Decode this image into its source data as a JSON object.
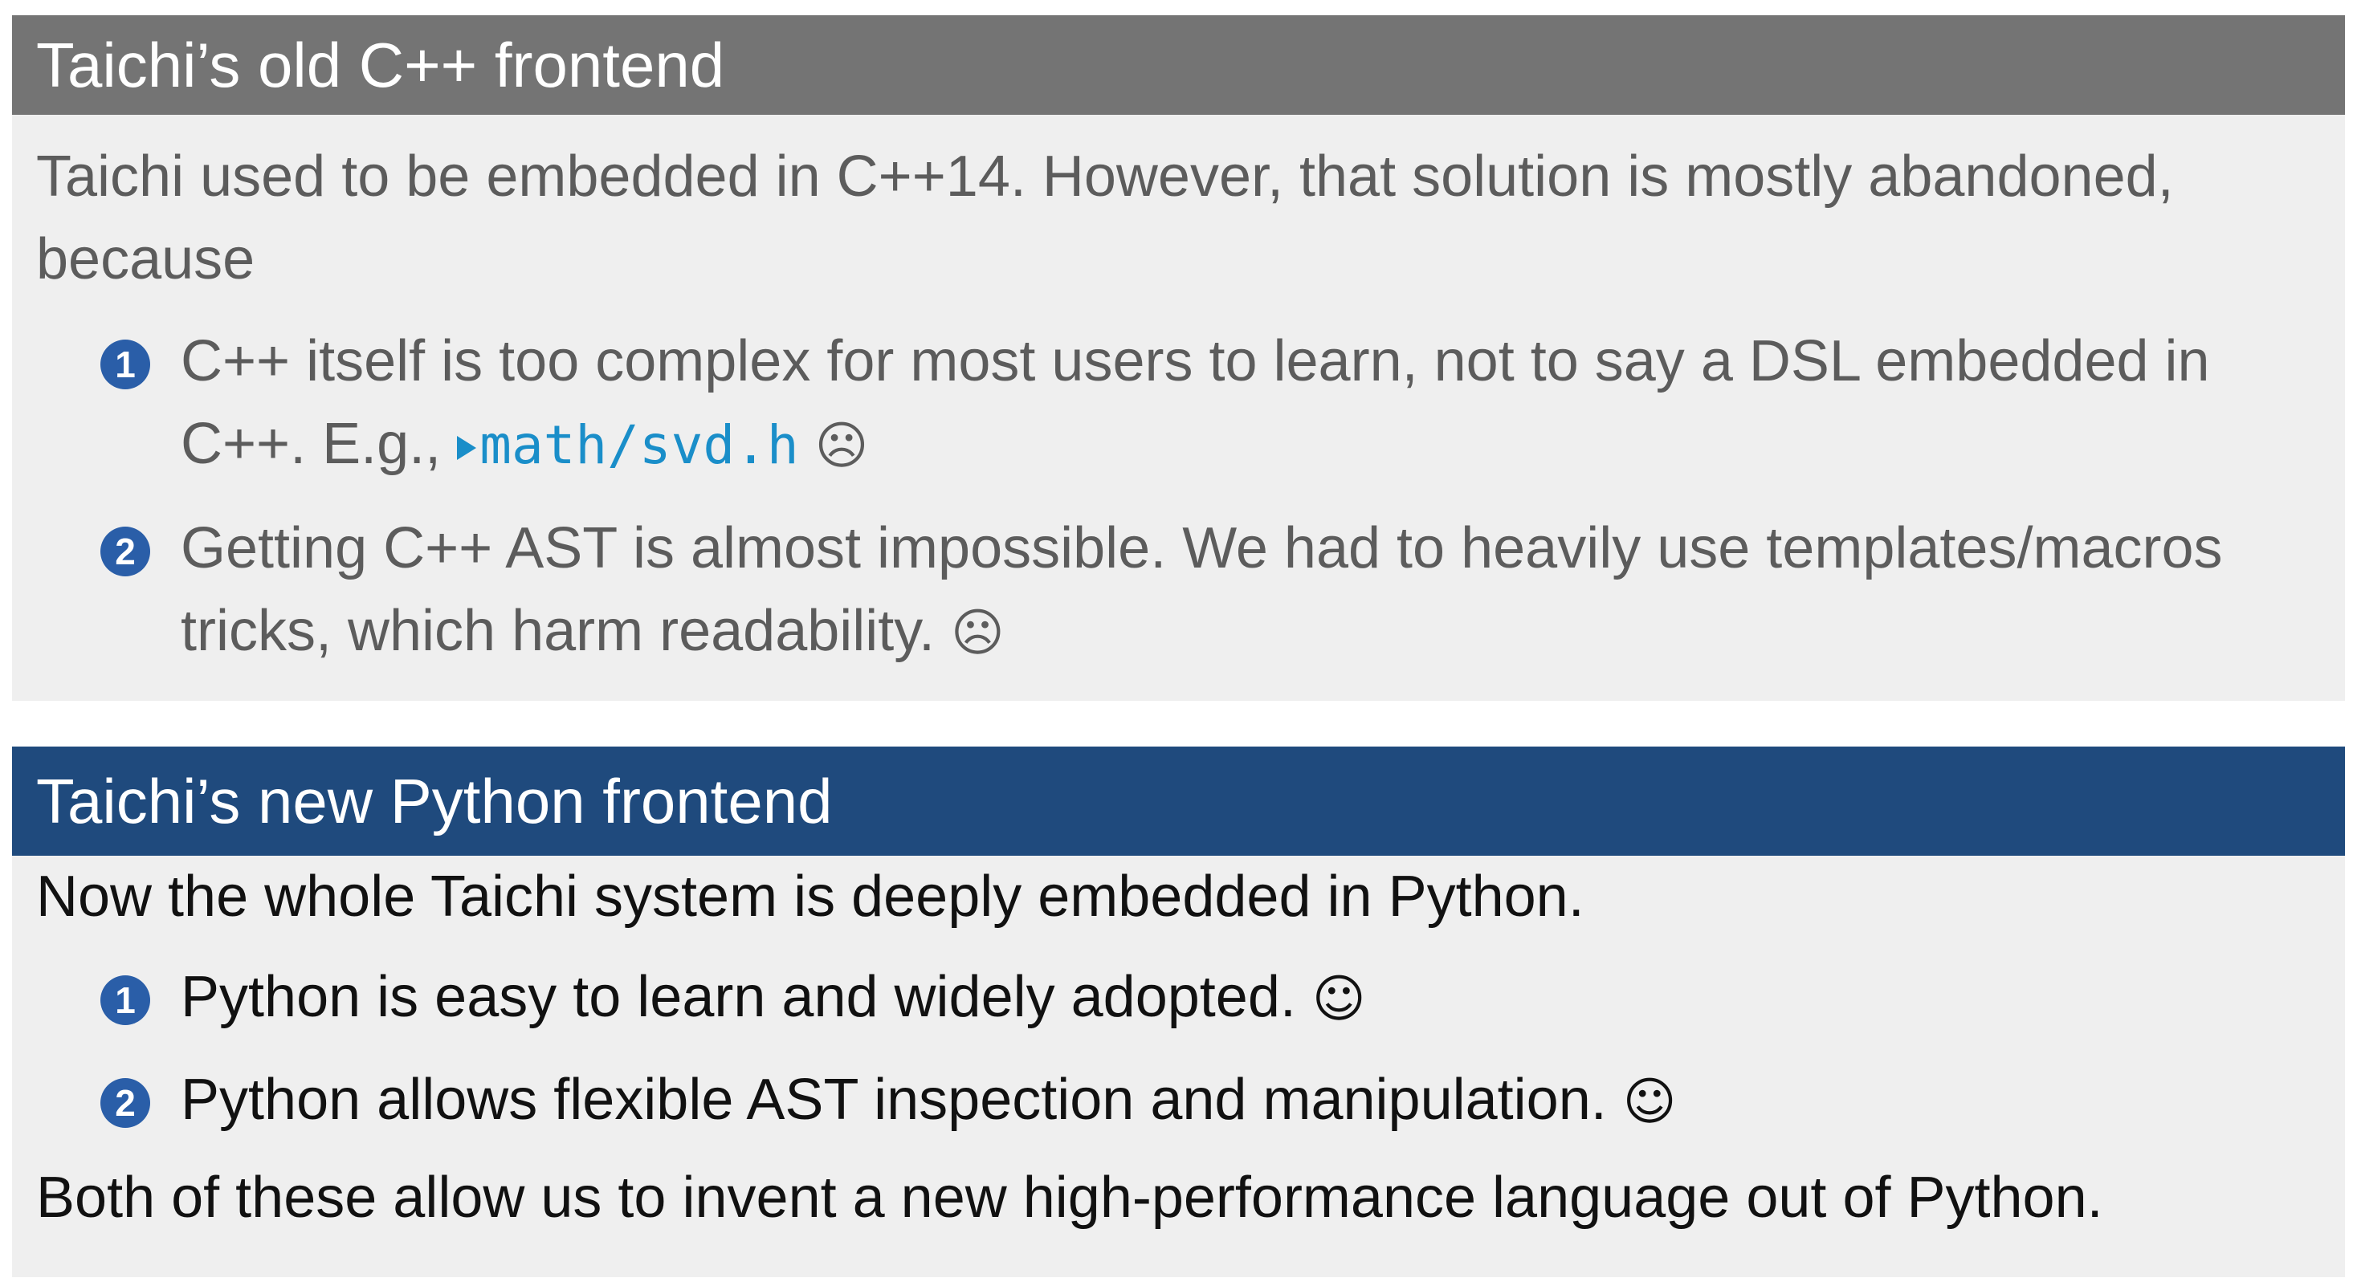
{
  "old_block": {
    "title": "Taichi’s old C++ frontend",
    "intro": "Taichi used to be embedded in C++14. However, that solution is mostly abandoned, because",
    "items": [
      {
        "number": "1",
        "text_before_link": "C++ itself is too complex for most users to learn, not to say a DSL embedded in C++. E.g.,",
        "link_text": "math/svd.h",
        "emoji": "☹"
      },
      {
        "number": "2",
        "text": "Getting C++ AST is almost impossible. We had to heavily use templates/macros tricks, which harm readability.",
        "emoji": "☹"
      }
    ]
  },
  "new_block": {
    "title": "Taichi’s new Python frontend",
    "intro": "Now the whole Taichi system is deeply embedded in Python.",
    "items": [
      {
        "number": "1",
        "text": "Python is easy to learn and widely adopted.",
        "emoji": "☺"
      },
      {
        "number": "2",
        "text": "Python allows flexible AST inspection and manipulation.",
        "emoji": "☺"
      }
    ],
    "conclusion": "Both of these allow us to invent a new high-performance language out of Python."
  },
  "colors": {
    "old_title_bg": "#747474",
    "new_title_bg": "#1f4a7d",
    "body_bg": "#efefef",
    "badge": "#2a5ea8",
    "link": "#1a8ec9"
  },
  "icons": {
    "link_arrow": "triangle-right-icon",
    "sad_face": "frowning-face-icon",
    "happy_face": "smiling-face-icon"
  }
}
